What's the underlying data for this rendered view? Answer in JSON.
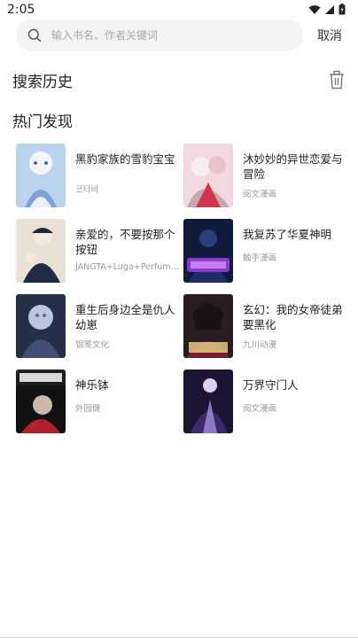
{
  "status": {
    "time": "2:05"
  },
  "search": {
    "placeholder": "输入书名、作者关键词",
    "cancel_label": "取消"
  },
  "history": {
    "title": "搜索历史"
  },
  "hot": {
    "title": "热门发现",
    "books": [
      {
        "title": "黑豹家族的雪豹宝宝",
        "author": "코타비"
      },
      {
        "title": "沐妙妙的异世恋爱与冒险",
        "author": "阅文漫画"
      },
      {
        "title": "亲爱的，不要按那个按钮",
        "author": "JANGTA+Luga+Perfumm…"
      },
      {
        "title": "我复苏了华夏神明",
        "author": "触手漫画"
      },
      {
        "title": "重生后身边全是仇人幼崽",
        "author": "银笺文化"
      },
      {
        "title": "玄幻：我的女帝徒弟要黑化",
        "author": "九川动漫"
      },
      {
        "title": "神乐钵",
        "author": "外园健"
      },
      {
        "title": "万界守门人",
        "author": "阅文漫画"
      }
    ]
  },
  "colors": {
    "background": "#ffffff",
    "search_bg": "#f2f3f5",
    "muted": "#9a9a9a"
  }
}
